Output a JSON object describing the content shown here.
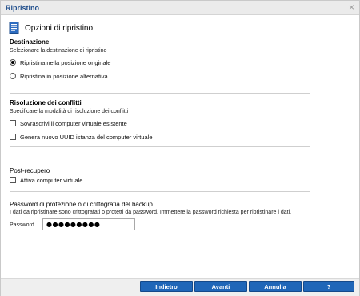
{
  "window": {
    "title": "Ripristino",
    "close_symbol": "×"
  },
  "header": {
    "title": "Opzioni di ripristino",
    "icon": "restore-document-icon"
  },
  "destination": {
    "title": "Destinazione",
    "description": "Selezionare la destinazione di ripristino",
    "options": [
      {
        "label": "Ripristina nella posizione originale",
        "selected": true
      },
      {
        "label": "Ripristina in posizione alternativa",
        "selected": false
      }
    ]
  },
  "conflicts": {
    "title": "Risoluzione dei conflitti",
    "description": "Specificare la modalità di risoluzione dei conflitti",
    "options": [
      {
        "label": "Sovrascrivi il computer virtuale esistente",
        "checked": false
      },
      {
        "label": "Genera nuovo UUID istanza del computer virtuale",
        "checked": false
      }
    ]
  },
  "post_recovery": {
    "title": "Post-recupero",
    "options": [
      {
        "label": "Attiva computer virtuale",
        "checked": false
      }
    ]
  },
  "backup_password": {
    "title": "Password di protezione o di crittografia del backup",
    "description": "I dati da ripristinare sono crittografati o protetti da password. Immettere la password richiesta per ripristinare i dati.",
    "field_label": "Password",
    "field_value": "●●●●●●●●●"
  },
  "buttons": {
    "back": "Indietro",
    "next": "Avanti",
    "cancel": "Annulla",
    "help": "?"
  },
  "colors": {
    "accent": "#1f66b8",
    "title_text": "#1f4e8c"
  }
}
